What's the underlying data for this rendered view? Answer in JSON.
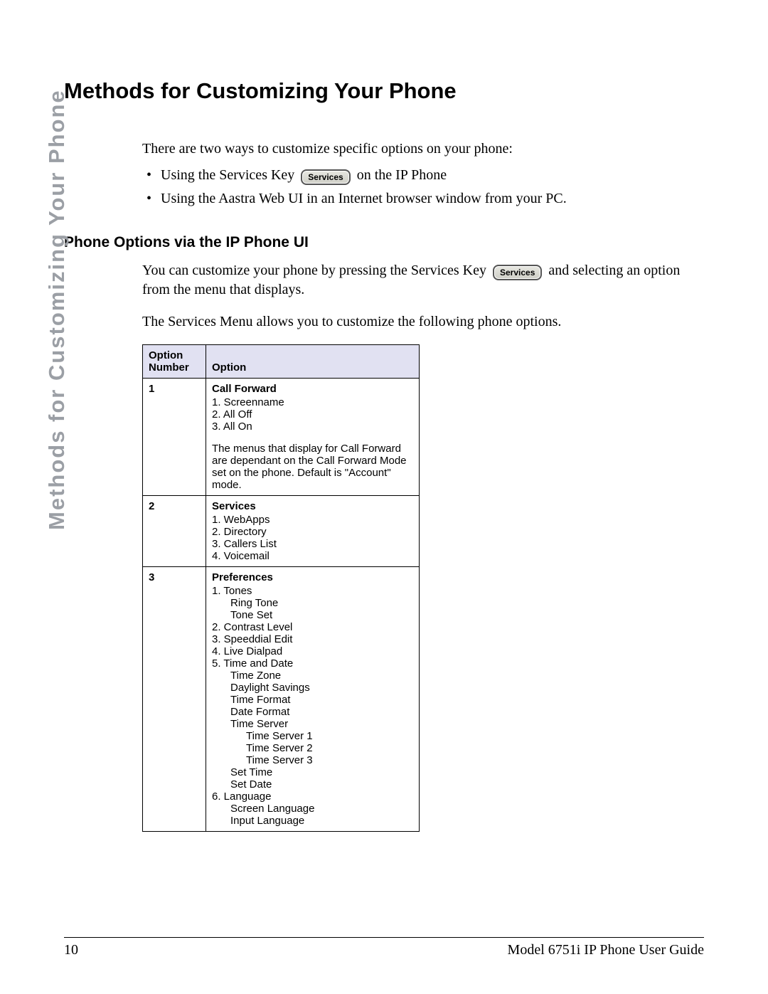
{
  "side_label": "Methods for Customizing Your Phone",
  "heading": "Methods for Customizing Your Phone",
  "intro": "There are two ways to customize specific options on your phone:",
  "bullet1_pre": "Using the Services Key",
  "bullet1_post": "on the IP Phone",
  "bullet2": "Using the Aastra Web UI in an Internet browser window from your PC.",
  "key_label": "Services",
  "subheading": "Phone Options via the IP Phone UI",
  "para1_pre": "You can customize your phone by pressing the Services Key",
  "para1_post": "and selecting an option from the menu that displays.",
  "para2": "The Services Menu allows you to customize the following phone options.",
  "table": {
    "header_col1": "Option Number",
    "header_col2": "Option",
    "rows": [
      {
        "num": "1",
        "title": "Call Forward",
        "lines": [
          "1. Screenname",
          "2. All Off",
          "3. All On"
        ],
        "note": "The menus that display for Call Forward are dependant on the Call Forward Mode set on the phone. Default is \"Account\" mode."
      },
      {
        "num": "2",
        "title": "Services",
        "lines": [
          "1. WebApps",
          "2. Directory",
          "3. Callers List",
          "4. Voicemail"
        ]
      },
      {
        "num": "3",
        "title": "Preferences",
        "pref": {
          "l1": "1. Tones",
          "l1a": "Ring Tone",
          "l1b": "Tone Set",
          "l2": "2. Contrast Level",
          "l3": "3. Speeddial Edit",
          "l4": "4. Live Dialpad",
          "l5": "5. Time and Date",
          "l5a": "Time Zone",
          "l5b": "Daylight Savings",
          "l5c": "Time Format",
          "l5d": "Date Format",
          "l5e": "Time Server",
          "l5e1": "Time Server 1",
          "l5e2": "Time Server 2",
          "l5e3": "Time Server 3",
          "l5f": "Set Time",
          "l5g": "Set Date",
          "l6": "6. Language",
          "l6a": "Screen Language",
          "l6b": "Input Language"
        }
      }
    ]
  },
  "footer": {
    "page": "10",
    "title": "Model 6751i IP Phone User Guide"
  }
}
